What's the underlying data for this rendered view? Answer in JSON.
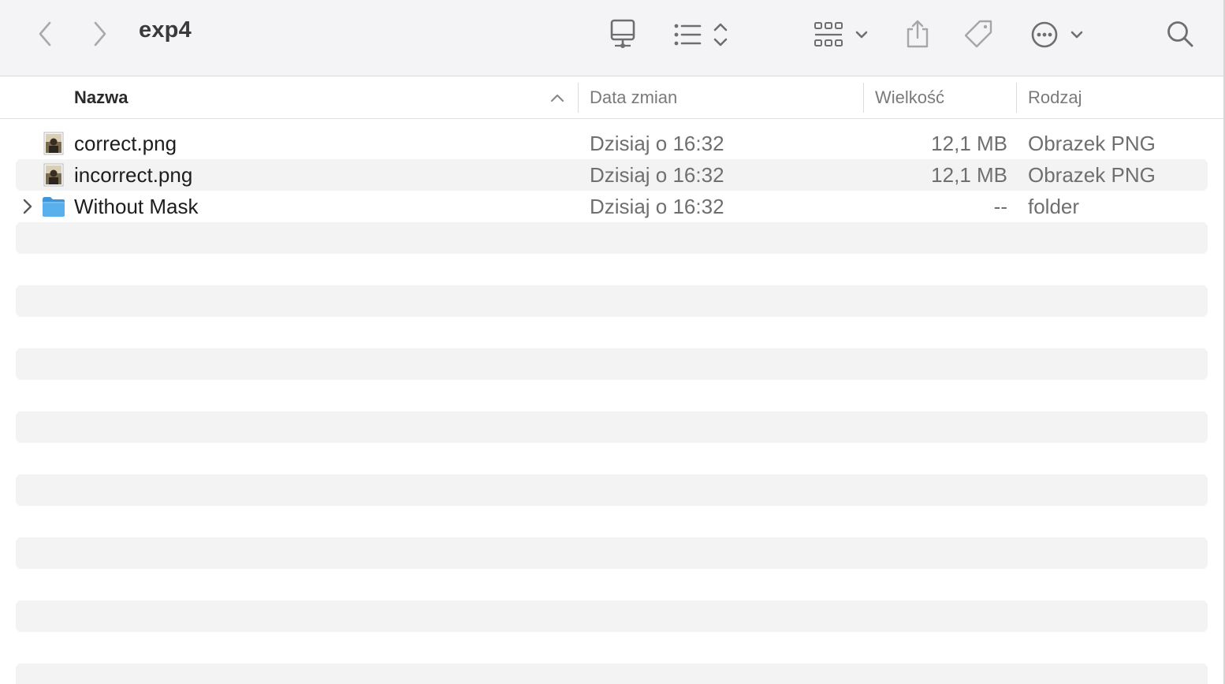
{
  "window": {
    "title": "exp4"
  },
  "toolbar": {
    "back_icon": "chevron-left-icon",
    "forward_icon": "chevron-right-icon",
    "items": [
      "computer-icon",
      "list-view-icon",
      "group-icon",
      "share-icon",
      "tag-icon",
      "more-icon",
      "search-icon"
    ]
  },
  "columns": {
    "name": "Nazwa",
    "date": "Data zmian",
    "size": "Wielkość",
    "kind": "Rodzaj"
  },
  "files": [
    {
      "name": "correct.png",
      "date": "Dzisiaj o 16:32",
      "size": "12,1 MB",
      "kind": "Obrazek PNG",
      "icon": "png-image-icon"
    },
    {
      "name": "incorrect.png",
      "date": "Dzisiaj o 16:32",
      "size": "12,1 MB",
      "kind": "Obrazek PNG",
      "icon": "png-image-icon"
    },
    {
      "name": "Without Mask",
      "date": "Dzisiaj o 16:32",
      "size": "--",
      "kind": "folder",
      "icon": "folder-icon"
    }
  ],
  "colors": {
    "toolbar_bg": "#f4f4f6",
    "row_alt": "#f3f3f3",
    "folder_blue": "#5ab0ec"
  }
}
